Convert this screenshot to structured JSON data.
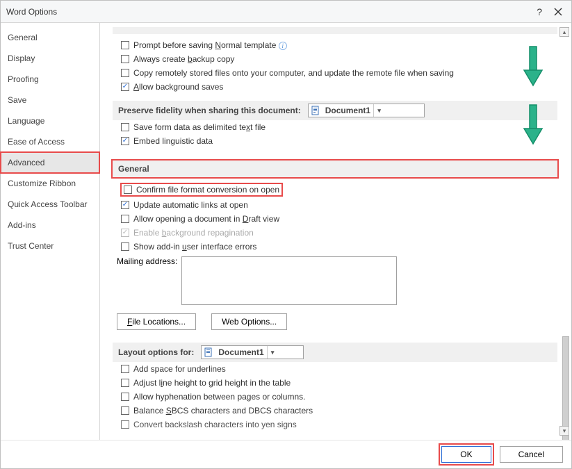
{
  "title": "Word Options",
  "sidebar": {
    "items": [
      {
        "label": "General"
      },
      {
        "label": "Display"
      },
      {
        "label": "Proofing"
      },
      {
        "label": "Save"
      },
      {
        "label": "Language"
      },
      {
        "label": "Ease of Access"
      },
      {
        "label": "Advanced"
      },
      {
        "label": "Customize Ribbon"
      },
      {
        "label": "Quick Access Toolbar"
      },
      {
        "label": "Add-ins"
      },
      {
        "label": "Trust Center"
      }
    ]
  },
  "save_section": {
    "prompt_normal_pre": "Prompt before saving ",
    "prompt_normal_u": "N",
    "prompt_normal_post": "ormal template",
    "backup_pre": "Always create ",
    "backup_u": "b",
    "backup_post": "ackup copy",
    "remote": "Copy remotely stored files onto your computer, and update the remote file when saving",
    "bg_saves_u": "A",
    "bg_saves_post": "llow background saves"
  },
  "preserve": {
    "header": "Preserve fidelity when sharing this document:",
    "doc": "Document1",
    "save_form_pre": "Save form data as delimited te",
    "save_form_u": "x",
    "save_form_post": "t file",
    "embed": "Embed linguistic data"
  },
  "general": {
    "header": "General",
    "conversion": "Confirm file format conversion on open",
    "update_links": "Update automatic links at open",
    "draft_pre": "Allow opening a document in ",
    "draft_u": "D",
    "draft_post": "raft view",
    "repag_pre": "Enable ",
    "repag_u": "b",
    "repag_post": "ackground repagination",
    "addin_pre": "Show add-in ",
    "addin_u": "u",
    "addin_post": "ser interface errors",
    "mailing_label": "Mailing address:",
    "file_locations": "File Locations...",
    "web_options": "Web Options..."
  },
  "layout": {
    "header": "Layout options for:",
    "doc": "Document1",
    "underlines": "Add space for underlines",
    "adjust_pre": "Adjust l",
    "adjust_u": "i",
    "adjust_post": "ne height to grid height in the table",
    "hyphenation": "Allow hyphenation between pages or columns.",
    "sbcs_pre": "Balance ",
    "sbcs_u": "S",
    "sbcs_post": "BCS characters and DBCS characters",
    "yen": "Convert backslash characters into yen signs"
  },
  "footer": {
    "ok": "OK",
    "cancel": "Cancel"
  }
}
